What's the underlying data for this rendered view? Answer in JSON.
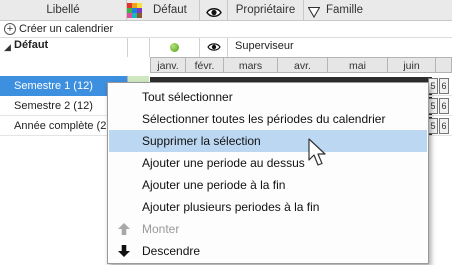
{
  "header": {
    "col_label": "Libellé",
    "col_default": "Défaut",
    "col_owner": "Propriétaire",
    "col_family": "Famille",
    "icons": [
      "color-palette-icon",
      "eye-icon",
      "filter-funnel-icon"
    ]
  },
  "toolbar": {
    "create_calendar": "Créer un calendrier"
  },
  "group": {
    "name": "Défaut",
    "owner": "Superviseur",
    "status_color": "#4f9d14"
  },
  "months": [
    "janv.",
    "févr.",
    "mars",
    "avr.",
    "mai",
    "juin"
  ],
  "rows": [
    {
      "label": "Semestre 1 (12)",
      "selected": true,
      "num1": "5",
      "num2": "6"
    },
    {
      "label": "Semestre 2 (12)",
      "selected": false,
      "num1": "5",
      "num2": "6"
    },
    {
      "label": "Année complète (2",
      "selected": false,
      "num1": "5",
      "num2": "6"
    }
  ],
  "context_menu": {
    "items": [
      {
        "label": "Tout sélectionner",
        "enabled": true
      },
      {
        "label": "Sélectionner toutes les périodes du calendrier",
        "enabled": true
      },
      {
        "label": "Supprimer la sélection",
        "enabled": true,
        "hover": true
      },
      {
        "label": "Ajouter une periode au dessus",
        "enabled": true
      },
      {
        "label": "Ajouter une periode à la fin",
        "enabled": true
      },
      {
        "label": "Ajouter plusieurs periodes à la fin",
        "enabled": true
      },
      {
        "label": "Monter",
        "enabled": false,
        "icon": "arrow-up-icon"
      },
      {
        "label": "Descendre",
        "enabled": true,
        "icon": "arrow-down-icon"
      }
    ]
  },
  "colors": {
    "selection": "#3d8fe0",
    "menu_hover": "#bcd7f1",
    "header_bg": "#eaeaea"
  }
}
